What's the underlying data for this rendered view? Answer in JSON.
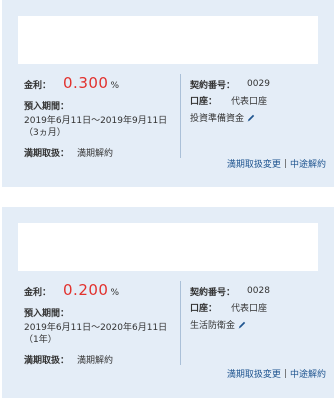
{
  "deposits": [
    {
      "rate_label": "金利：",
      "rate_value": "0.300",
      "rate_unit": "%",
      "period_label": "預入期間：",
      "period_value": "2019年6月11日～2019年9月11日（3ヵ月）",
      "handling_label": "満期取扱：",
      "handling_value": "満期解約",
      "contract_label": "契約番号：",
      "contract_value": "0029",
      "account_label": "口座：",
      "account_value": "代表口座",
      "purpose": "投資準備資金",
      "link_change": "満期取扱変更",
      "link_sep": "|",
      "link_cancel": "中途解約"
    },
    {
      "rate_label": "金利：",
      "rate_value": "0.200",
      "rate_unit": "%",
      "period_label": "預入期間：",
      "period_value": "2019年6月11日～2020年6月11日（1年）",
      "handling_label": "満期取扱：",
      "handling_value": "満期解約",
      "contract_label": "契約番号：",
      "contract_value": "0028",
      "account_label": "口座：",
      "account_value": "代表口座",
      "purpose": "生活防衛金",
      "link_change": "満期取扱変更",
      "link_sep": "|",
      "link_cancel": "中途解約"
    }
  ],
  "colors": {
    "card_bg": "#e4edf7",
    "rate": "#e2312d",
    "link": "#1f5590"
  },
  "icons": [
    "pencil-icon"
  ]
}
